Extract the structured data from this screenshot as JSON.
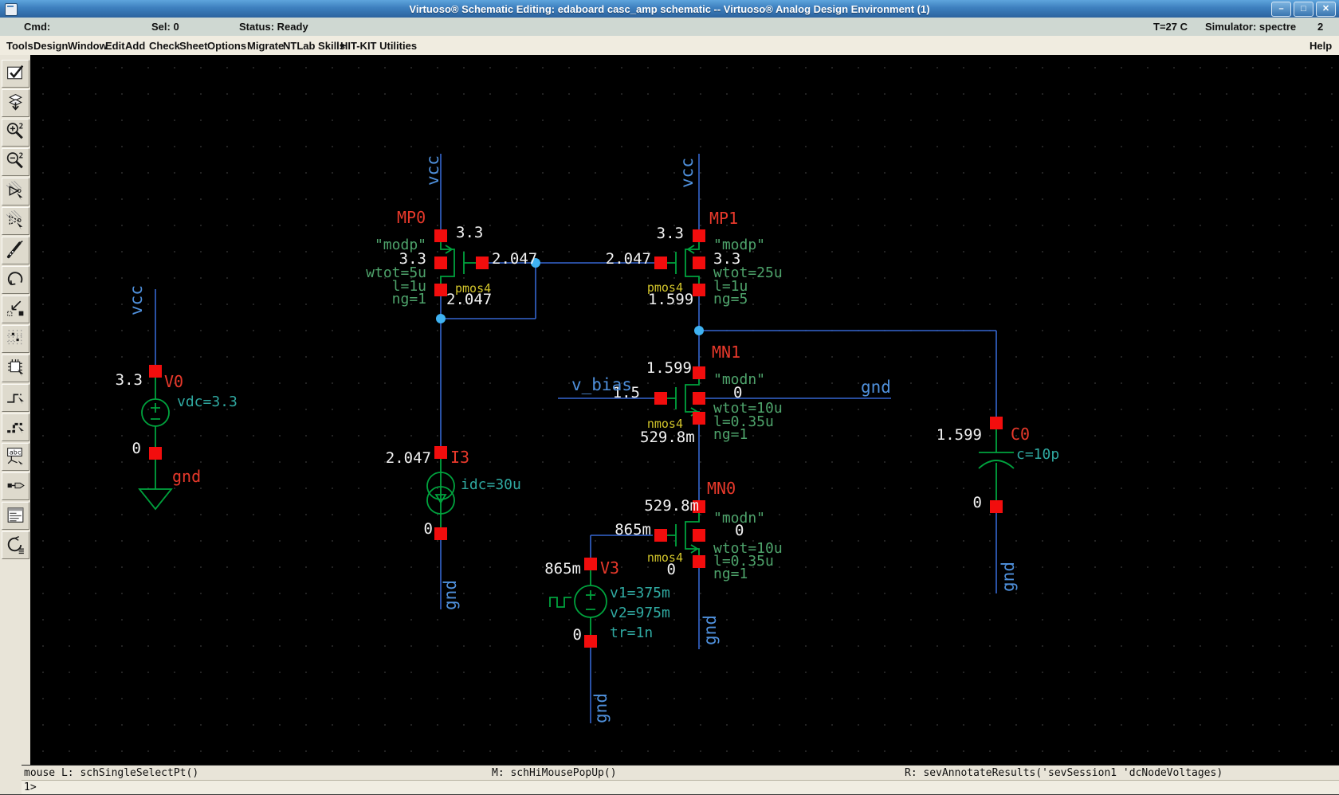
{
  "window": {
    "title": "Virtuoso® Schematic Editing: edaboard casc_amp schematic -- Virtuoso® Analog Design Environment (1)",
    "minimize": "–",
    "maximize": "□",
    "close": "✕"
  },
  "status_row": {
    "cmd_label": "Cmd:",
    "selection": "Sel: 0",
    "status": "Status: Ready",
    "temperature": "T=27 C",
    "simulator": "Simulator: spectre",
    "count": "2"
  },
  "menu": {
    "items": [
      "Tools",
      "Design",
      "Window",
      "Edit",
      "Add",
      "Check",
      "Sheet",
      "Options",
      "Migrate",
      "NTLab Skills",
      "HIT-KIT Utilities"
    ],
    "help": "Help"
  },
  "toolbar_icons": [
    "check-and-save",
    "save",
    "zoom-in-2x",
    "zoom-out-2x",
    "select-copy",
    "select-move",
    "probe-pen",
    "undo",
    "stretch",
    "area-pattern",
    "instance",
    "wire",
    "wide-wire",
    "wire-label",
    "pin",
    "properties-form",
    "repeat"
  ],
  "sch": {
    "nets": {
      "vcc": "vcc",
      "gnd": "gnd",
      "vbias": "v_bias"
    },
    "v0": {
      "name": "V0",
      "param": "vdc=3.3",
      "v_plus": "3.3",
      "v_minus": "0"
    },
    "i3": {
      "name": "I3",
      "param": "idc=30u",
      "v_top": "2.047",
      "v_bot": "0"
    },
    "v3": {
      "name": "V3",
      "param1": "v1=375m",
      "param2": "v2=975m",
      "param3": "tr=1n",
      "v_top": "865m",
      "v_bot": "0"
    },
    "c0": {
      "name": "C0",
      "param": "c=10p",
      "v_top": "1.599",
      "v_bot": "0"
    },
    "mp0": {
      "name": "MP0",
      "model": "\"modp\"",
      "w": "wtot=5u",
      "l": "l=1u",
      "ng": "ng=1",
      "cell": "pmos4",
      "v_src": "3.3",
      "v_bulk": "3.3",
      "v_gate": "2.047",
      "v_drain": "2.047"
    },
    "mp1": {
      "name": "MP1",
      "model": "\"modp\"",
      "w": "wtot=25u",
      "l": "l=1u",
      "ng": "ng=5",
      "cell": "pmos4",
      "v_src": "3.3",
      "v_bulk": "3.3",
      "v_gate": "2.047",
      "v_drain": "1.599"
    },
    "mn1": {
      "name": "MN1",
      "model": "\"modn\"",
      "w": "wtot=10u",
      "l": "l=0.35u",
      "ng": "ng=1",
      "cell": "nmos4",
      "v_drain": "1.599",
      "v_gate": "1.5",
      "v_bulk": "0",
      "v_src": "529.8m"
    },
    "mn0": {
      "name": "MN0",
      "model": "\"modn\"",
      "w": "wtot=10u",
      "l": "l=0.35u",
      "ng": "ng=1",
      "cell": "nmos4",
      "v_drain": "529.8m",
      "v_gate": "865m",
      "v_bulk": "0",
      "v_src": "0"
    }
  },
  "footer": {
    "mouse_left": "mouse L: schSingleSelectPt()",
    "mouse_middle": "M: schHiMousePopUp()",
    "mouse_right": "R: sevAnnotateResults('sevSession1 'dcNodeVoltages)",
    "prompt": "1>"
  },
  "colors": {
    "wire": "#3566cf",
    "net_label": "#4f90dc",
    "junction": "#3fb2f2",
    "symbol_green": "#00a33e",
    "param_green": "#4ea36b",
    "param_teal": "#2fa8a0",
    "cell_yellow": "#d2c52b",
    "instance_red": "#e8392b",
    "marker_red": "#f20d0d",
    "annotation_white": "#f2f2f2",
    "titlebar_blue": "#3d7fbe"
  }
}
